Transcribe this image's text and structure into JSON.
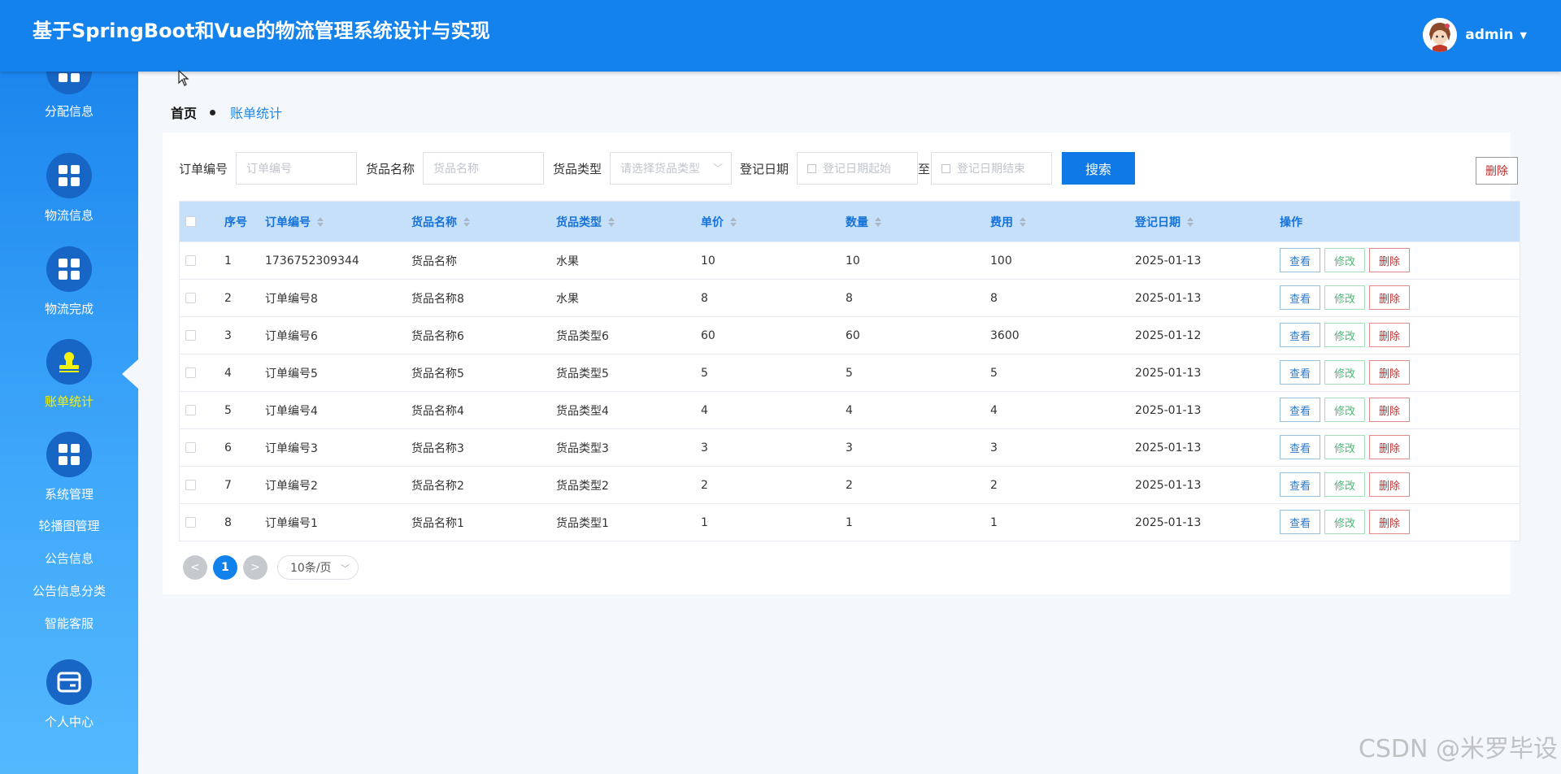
{
  "header": {
    "title": "基于SpringBoot和Vue的物流管理系统设计与实现",
    "username": "admin"
  },
  "sidebar": {
    "items": [
      {
        "label": "分配信息",
        "icon": "grid-icon"
      },
      {
        "label": "物流信息",
        "icon": "grid-icon"
      },
      {
        "label": "物流完成",
        "icon": "grid-icon"
      },
      {
        "label": "账单统计",
        "icon": "stamp-icon",
        "active": true
      },
      {
        "label": "系统管理",
        "icon": "grid-icon"
      },
      {
        "label": "轮播图管理"
      },
      {
        "label": "公告信息"
      },
      {
        "label": "公告信息分类"
      },
      {
        "label": "智能客服"
      },
      {
        "label": "个人中心",
        "icon": "card-icon"
      }
    ]
  },
  "breadcrumb": {
    "home": "首页",
    "current": "账单统计"
  },
  "search": {
    "order_label": "订单编号",
    "order_placeholder": "订单编号",
    "goods_label": "货品名称",
    "goods_placeholder": "货品名称",
    "type_label": "货品类型",
    "type_placeholder": "请选择货品类型",
    "date_label": "登记日期",
    "date_start_placeholder": "登记日期起始",
    "date_to": "至",
    "date_end_placeholder": "登记日期结束",
    "search_button": "搜索",
    "delete_button": "删除"
  },
  "table": {
    "headers": {
      "index": "序号",
      "order": "订单编号",
      "goods": "货品名称",
      "type": "货品类型",
      "price": "单价",
      "qty": "数量",
      "fee": "费用",
      "date": "登记日期",
      "ops": "操作"
    },
    "actions": {
      "view": "查看",
      "edit": "修改",
      "delete": "删除"
    },
    "rows": [
      {
        "index": "1",
        "order": "1736752309344",
        "goods": "货品名称",
        "type": "水果",
        "price": "10",
        "qty": "10",
        "fee": "100",
        "date": "2025-01-13"
      },
      {
        "index": "2",
        "order": "订单编号8",
        "goods": "货品名称8",
        "type": "水果",
        "price": "8",
        "qty": "8",
        "fee": "8",
        "date": "2025-01-13"
      },
      {
        "index": "3",
        "order": "订单编号6",
        "goods": "货品名称6",
        "type": "货品类型6",
        "price": "60",
        "qty": "60",
        "fee": "3600",
        "date": "2025-01-12"
      },
      {
        "index": "4",
        "order": "订单编号5",
        "goods": "货品名称5",
        "type": "货品类型5",
        "price": "5",
        "qty": "5",
        "fee": "5",
        "date": "2025-01-13"
      },
      {
        "index": "5",
        "order": "订单编号4",
        "goods": "货品名称4",
        "type": "货品类型4",
        "price": "4",
        "qty": "4",
        "fee": "4",
        "date": "2025-01-13"
      },
      {
        "index": "6",
        "order": "订单编号3",
        "goods": "货品名称3",
        "type": "货品类型3",
        "price": "3",
        "qty": "3",
        "fee": "3",
        "date": "2025-01-13"
      },
      {
        "index": "7",
        "order": "订单编号2",
        "goods": "货品名称2",
        "type": "货品类型2",
        "price": "2",
        "qty": "2",
        "fee": "2",
        "date": "2025-01-13"
      },
      {
        "index": "8",
        "order": "订单编号1",
        "goods": "货品名称1",
        "type": "货品类型1",
        "price": "1",
        "qty": "1",
        "fee": "1",
        "date": "2025-01-13"
      }
    ]
  },
  "pagination": {
    "prev": "<",
    "current": "1",
    "next": ">",
    "page_size": "10条/页"
  },
  "watermark": "CSDN @米罗毕设",
  "colors": {
    "primary": "#1382ec",
    "active_menu": "#f2f30e",
    "danger": "#c62f2f",
    "success": "#4cb877"
  }
}
